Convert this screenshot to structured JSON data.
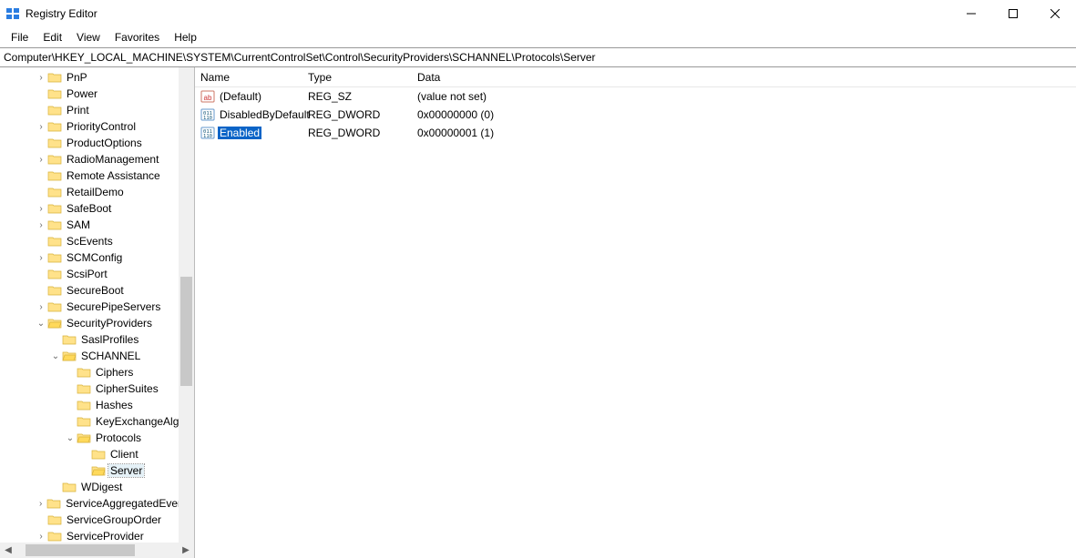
{
  "window": {
    "title": "Registry Editor"
  },
  "menu": {
    "file": "File",
    "edit": "Edit",
    "view": "View",
    "favorites": "Favorites",
    "help": "Help"
  },
  "address": "Computer\\HKEY_LOCAL_MACHINE\\SYSTEM\\CurrentControlSet\\Control\\SecurityProviders\\SCHANNEL\\Protocols\\Server",
  "tree": {
    "items": [
      {
        "indent": 2,
        "toggle": ">",
        "label": "PnP"
      },
      {
        "indent": 2,
        "toggle": "",
        "label": "Power"
      },
      {
        "indent": 2,
        "toggle": "",
        "label": "Print"
      },
      {
        "indent": 2,
        "toggle": ">",
        "label": "PriorityControl"
      },
      {
        "indent": 2,
        "toggle": "",
        "label": "ProductOptions"
      },
      {
        "indent": 2,
        "toggle": ">",
        "label": "RadioManagement"
      },
      {
        "indent": 2,
        "toggle": "",
        "label": "Remote Assistance"
      },
      {
        "indent": 2,
        "toggle": "",
        "label": "RetailDemo"
      },
      {
        "indent": 2,
        "toggle": ">",
        "label": "SafeBoot"
      },
      {
        "indent": 2,
        "toggle": ">",
        "label": "SAM"
      },
      {
        "indent": 2,
        "toggle": "",
        "label": "ScEvents"
      },
      {
        "indent": 2,
        "toggle": ">",
        "label": "SCMConfig"
      },
      {
        "indent": 2,
        "toggle": "",
        "label": "ScsiPort"
      },
      {
        "indent": 2,
        "toggle": "",
        "label": "SecureBoot"
      },
      {
        "indent": 2,
        "toggle": ">",
        "label": "SecurePipeServers"
      },
      {
        "indent": 2,
        "toggle": "v",
        "label": "SecurityProviders"
      },
      {
        "indent": 3,
        "toggle": "",
        "label": "SaslProfiles"
      },
      {
        "indent": 3,
        "toggle": "v",
        "label": "SCHANNEL"
      },
      {
        "indent": 4,
        "toggle": "",
        "label": "Ciphers"
      },
      {
        "indent": 4,
        "toggle": "",
        "label": "CipherSuites"
      },
      {
        "indent": 4,
        "toggle": "",
        "label": "Hashes"
      },
      {
        "indent": 4,
        "toggle": "",
        "label": "KeyExchangeAlgor"
      },
      {
        "indent": 4,
        "toggle": "v",
        "label": "Protocols"
      },
      {
        "indent": 5,
        "toggle": "",
        "label": "Client"
      },
      {
        "indent": 5,
        "toggle": "",
        "label": "Server",
        "selected": true
      },
      {
        "indent": 3,
        "toggle": "",
        "label": "WDigest"
      },
      {
        "indent": 2,
        "toggle": ">",
        "label": "ServiceAggregatedEvents"
      },
      {
        "indent": 2,
        "toggle": "",
        "label": "ServiceGroupOrder"
      },
      {
        "indent": 2,
        "toggle": ">",
        "label": "ServiceProvider"
      }
    ]
  },
  "columns": {
    "name": "Name",
    "type": "Type",
    "data": "Data"
  },
  "values": [
    {
      "icon": "string",
      "name": "(Default)",
      "type": "REG_SZ",
      "data": "(value not set)",
      "selected": false
    },
    {
      "icon": "binary",
      "name": "DisabledByDefault",
      "type": "REG_DWORD",
      "data": "0x00000000 (0)",
      "selected": false
    },
    {
      "icon": "binary",
      "name": "Enabled",
      "type": "REG_DWORD",
      "data": "0x00000001 (1)",
      "selected": true
    }
  ]
}
